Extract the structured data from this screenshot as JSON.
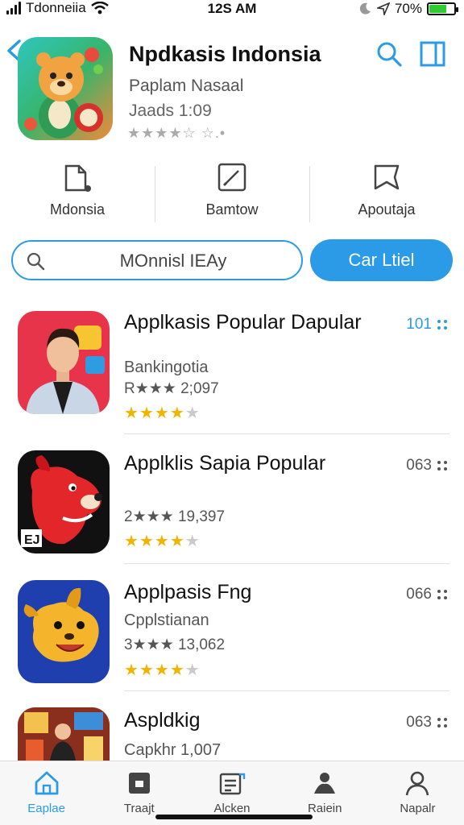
{
  "status_bar": {
    "carrier": "Tdonneiia",
    "time": "12S AM",
    "battery": "70%",
    "battery_level": 0.7
  },
  "header": {
    "back_icon": "chevron-left-icon",
    "title": "Npdkasis Indonsia",
    "subtitle": "Paplam Nasaal",
    "date": "Jaads 1:09",
    "rating_stars": "★★★★☆ ☆.•",
    "search_icon": "search-icon",
    "panel_icon": "sidebar-panel-icon"
  },
  "actions": [
    {
      "label": "Mdonsia",
      "icon": "document-icon"
    },
    {
      "label": "Bamtow",
      "icon": "edit-icon"
    },
    {
      "label": "Apoutaja",
      "icon": "bookmark-icon"
    }
  ],
  "search": {
    "value": "MOnnisl IEAy",
    "button_label": "Car Ltiel"
  },
  "apps": [
    {
      "title": "Applkasis Popular Dapular",
      "subtitle": "Bankingotia",
      "meta": "R★★★ 2;097",
      "rating": 4,
      "count": "101",
      "count_accent": true
    },
    {
      "title": "Applklis Sapia Popular",
      "subtitle": "",
      "meta": "2★★★ 19,397",
      "rating": 4,
      "count": "063",
      "count_accent": false
    },
    {
      "title": "Applpasis Fng",
      "subtitle": "Cpplstianan",
      "meta": "3★★★ 13,062",
      "rating": 4,
      "count": "066",
      "count_accent": false
    },
    {
      "title": "Aspldkig",
      "subtitle": "Capkhr 1,007",
      "meta": "",
      "rating": 0,
      "count": "063",
      "count_accent": false
    }
  ],
  "tabs": [
    {
      "label": "Eaplae",
      "icon": "home-icon",
      "active": true
    },
    {
      "label": "Traajt",
      "icon": "calendar-icon",
      "active": false
    },
    {
      "label": "Alcken",
      "icon": "list-chart-icon",
      "active": false
    },
    {
      "label": "Raiein",
      "icon": "person-pin-icon",
      "active": false
    },
    {
      "label": "Napalr",
      "icon": "profile-icon",
      "active": false
    }
  ],
  "colors": {
    "accent": "#2b9be8",
    "star": "#f0b400",
    "battery": "#2ecc2e"
  }
}
